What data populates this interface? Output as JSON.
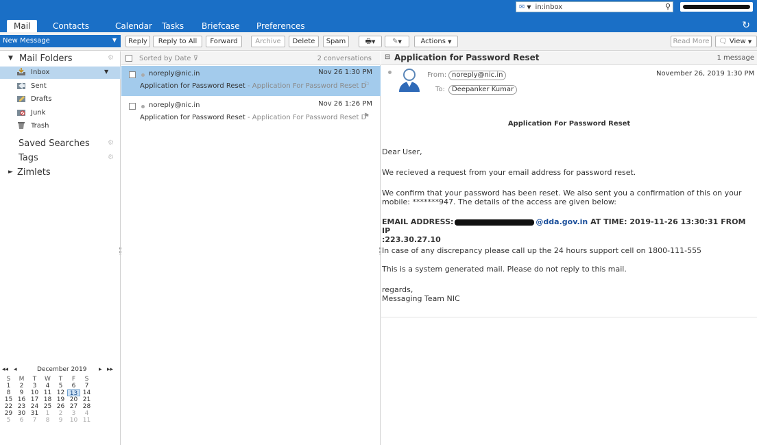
{
  "search": {
    "scope": "in:inbox"
  },
  "apptabs": [
    "Mail",
    "Contacts",
    "Calendar",
    "Tasks",
    "Briefcase",
    "Preferences"
  ],
  "toolbar": {
    "new_message": "New Message",
    "reply": "Reply",
    "reply_all": "Reply to All",
    "forward": "Forward",
    "archive": "Archive",
    "delete": "Delete",
    "spam": "Spam",
    "actions": "Actions",
    "read_more": "Read More",
    "view": "View"
  },
  "sidebar": {
    "mail_folders": "Mail Folders",
    "folders": [
      {
        "label": "Inbox",
        "icon": "inbox-icon"
      },
      {
        "label": "Sent",
        "icon": "sent-icon"
      },
      {
        "label": "Drafts",
        "icon": "drafts-icon"
      },
      {
        "label": "Junk",
        "icon": "junk-icon"
      },
      {
        "label": "Trash",
        "icon": "trash-icon"
      }
    ],
    "saved_searches": "Saved Searches",
    "tags": "Tags",
    "zimlets": "Zimlets"
  },
  "calendar": {
    "month": "December 2019",
    "dow": [
      "S",
      "M",
      "T",
      "W",
      "T",
      "F",
      "S"
    ],
    "weeks": [
      [
        "1",
        "2",
        "3",
        "4",
        "5",
        "6",
        "7"
      ],
      [
        "8",
        "9",
        "10",
        "11",
        "12",
        "13",
        "14"
      ],
      [
        "15",
        "16",
        "17",
        "18",
        "19",
        "20",
        "21"
      ],
      [
        "22",
        "23",
        "24",
        "25",
        "26",
        "27",
        "28"
      ],
      [
        "29",
        "30",
        "31",
        "1",
        "2",
        "3",
        "4"
      ],
      [
        "5",
        "6",
        "7",
        "8",
        "9",
        "10",
        "11"
      ]
    ],
    "today": "13"
  },
  "list": {
    "sort": "Sorted by Date",
    "count": "2 conversations",
    "messages": [
      {
        "from": "noreply@nic.in",
        "date": "Nov 26 1:30 PM",
        "subject": "Application for Password Reset",
        "fragment": " - Application For Password Reset D",
        "selected": true
      },
      {
        "from": "noreply@nic.in",
        "date": "Nov 26 1:26 PM",
        "subject": "Application for Password Reset",
        "fragment": " - Application For Password Reset D",
        "selected": false
      }
    ]
  },
  "reading": {
    "title": "Application for Password Reset",
    "count": "1 message",
    "from_label": "From:",
    "from": "noreply@nic.in",
    "to_label": "To:",
    "to": "Deepanker Kumar",
    "date": "November 26, 2019 1:30 PM",
    "heading": "Application For Password Reset",
    "greeting": "Dear User,",
    "p1": "We recieved a request from your email address for password reset.",
    "p2": "We confirm that your password has been reset. We also sent you a confirmation of this on your mobile: *******947. The details of the access are given below:",
    "email_label": "EMAIL ADDRESS:",
    "email_domain": "@dda.gov.in",
    "access_time": " AT TIME: 2019-11-26 13:30:31 FROM IP",
    "ip": ":223.30.27.10",
    "p3": "In case of any discrepancy please call up the 24 hours support cell on 1800-111-555",
    "p4": "This is a system generated mail. Please do not reply to this mail.",
    "closing": "regards,",
    "signature": "Messaging Team NIC"
  },
  "colors": {
    "accent": "#1a6fc6",
    "selected_row": "#a3cbec",
    "inbox_selected": "#bad6ee"
  }
}
